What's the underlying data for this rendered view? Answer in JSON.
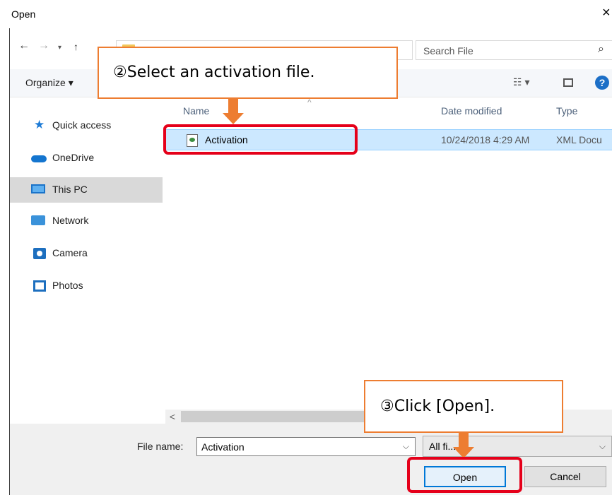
{
  "window": {
    "title": "Open",
    "close_glyph": "×"
  },
  "navigation": {
    "back_glyph": "←",
    "forward_glyph": "→",
    "recent_glyph": "▾",
    "up_glyph": "↑",
    "search_placeholder": "Search File",
    "search_icon_glyph": "⌕"
  },
  "toolbar": {
    "organize_label": "Organize ▾",
    "view_glyph": "☷ ▾",
    "help_glyph": "?"
  },
  "sidebar": {
    "items": [
      {
        "label": "Quick access",
        "icon": "star-icon"
      },
      {
        "label": "OneDrive",
        "icon": "cloud-icon"
      },
      {
        "label": "This PC",
        "icon": "computer-icon",
        "selected": true
      },
      {
        "label": "Network",
        "icon": "network-icon"
      },
      {
        "label": "Camera",
        "icon": "camera-icon"
      },
      {
        "label": "Photos",
        "icon": "photos-icon"
      }
    ]
  },
  "file_list": {
    "columns": {
      "name": "Name",
      "date": "Date modified",
      "type": "Type",
      "sort_glyph": "^"
    },
    "rows": [
      {
        "name": "Activation",
        "date": "10/24/2018 4:29 AM",
        "type": "XML Docu"
      }
    ],
    "scroll_left_glyph": "<"
  },
  "footer": {
    "file_name_label": "File name:",
    "file_name_value": "Activation",
    "file_name_chevron": "⌵",
    "filter_value": "All fi...",
    "filter_chevron": "⌵",
    "open_label": "Open",
    "cancel_label": "Cancel"
  },
  "annotations": {
    "step2": "②Select an activation file.",
    "step3": "③Click [Open].",
    "arrow_color": "#ed7d31",
    "highlight_color": "#e5001a"
  }
}
